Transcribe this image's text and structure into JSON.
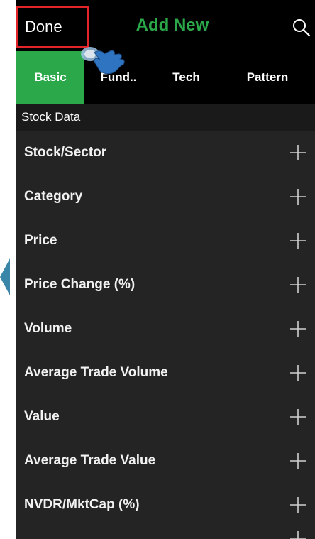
{
  "header": {
    "done_label": "Done",
    "title": "Add New"
  },
  "tabs": [
    {
      "label": "Basic",
      "active": true
    },
    {
      "label": "Fund..",
      "active": false
    },
    {
      "label": "Tech",
      "active": false
    },
    {
      "label": "Pattern",
      "active": false
    }
  ],
  "section": {
    "title": "Stock Data"
  },
  "items": [
    {
      "label": "Stock/Sector"
    },
    {
      "label": "Category"
    },
    {
      "label": "Price"
    },
    {
      "label": "Price Change (%)"
    },
    {
      "label": "Volume"
    },
    {
      "label": "Average Trade Volume"
    },
    {
      "label": "Value"
    },
    {
      "label": "Average Trade Value"
    },
    {
      "label": "NVDR/MktCap (%)"
    }
  ],
  "colors": {
    "accent_green": "#2aa84a",
    "highlight_red": "#e3242b",
    "background": "#242424"
  },
  "icons": {
    "search": "search-icon",
    "add": "plus-icon",
    "pointer": "hand-pointer-icon"
  }
}
